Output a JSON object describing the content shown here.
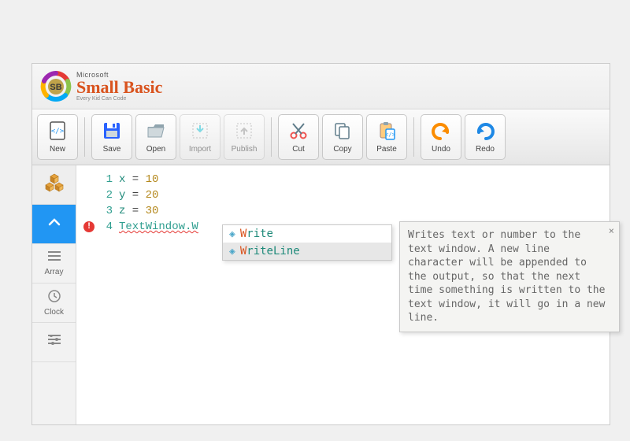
{
  "title": {
    "ms": "Microsoft",
    "name": "Small Basic",
    "tagline": "Every Kid Can Code"
  },
  "toolbar": {
    "new": "New",
    "save": "Save",
    "open": "Open",
    "import": "Import",
    "publish": "Publish",
    "cut": "Cut",
    "copy": "Copy",
    "paste": "Paste",
    "undo": "Undo",
    "redo": "Redo"
  },
  "sidebar": {
    "array": "Array",
    "clock": "Clock"
  },
  "code": {
    "lines": [
      {
        "n": "1",
        "var": "x",
        "eq": " = ",
        "val": "10"
      },
      {
        "n": "2",
        "var": "y",
        "eq": " = ",
        "val": "20"
      },
      {
        "n": "3",
        "var": "z",
        "eq": " = ",
        "val": "30"
      },
      {
        "n": "4",
        "obj": "TextWindow.W"
      }
    ]
  },
  "intellisense": {
    "items": [
      {
        "prefix": "W",
        "rest": "rite"
      },
      {
        "prefix": "W",
        "rest": "riteLine"
      }
    ]
  },
  "tooltip": {
    "text": "Writes text or number to the text window. A new line character will be appended to the output, so that the next time something is written to the text window, it will go in a new line.",
    "close": "×"
  }
}
